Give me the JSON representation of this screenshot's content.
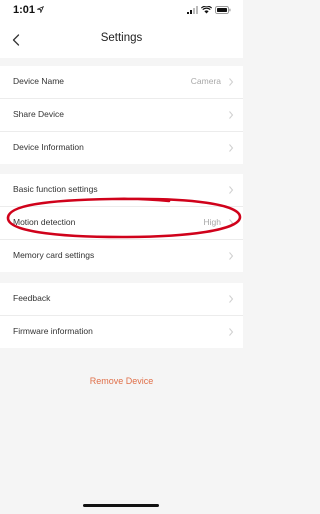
{
  "status_bar": {
    "time": "1:01",
    "icons": [
      "location-arrow-icon",
      "cellular-signal-icon",
      "wifi-icon",
      "battery-icon"
    ]
  },
  "nav": {
    "title": "Settings",
    "back_icon": "chevron-left-icon"
  },
  "groups": [
    {
      "rows": [
        {
          "label": "Device Name",
          "value": "Camera"
        },
        {
          "label": "Share Device",
          "value": ""
        },
        {
          "label": "Device Information",
          "value": ""
        }
      ]
    },
    {
      "rows": [
        {
          "label": "Basic function settings",
          "value": ""
        },
        {
          "label": "Motion detection",
          "value": "High"
        },
        {
          "label": "Memory card settings",
          "value": ""
        }
      ]
    },
    {
      "rows": [
        {
          "label": "Feedback",
          "value": ""
        },
        {
          "label": "Firmware information",
          "value": ""
        }
      ]
    }
  ],
  "remove_device_label": "Remove Device",
  "colors": {
    "background": "#f5f5f5",
    "row_background": "#ffffff",
    "remove_text": "#e0704a",
    "annotation": "#d0021b"
  }
}
